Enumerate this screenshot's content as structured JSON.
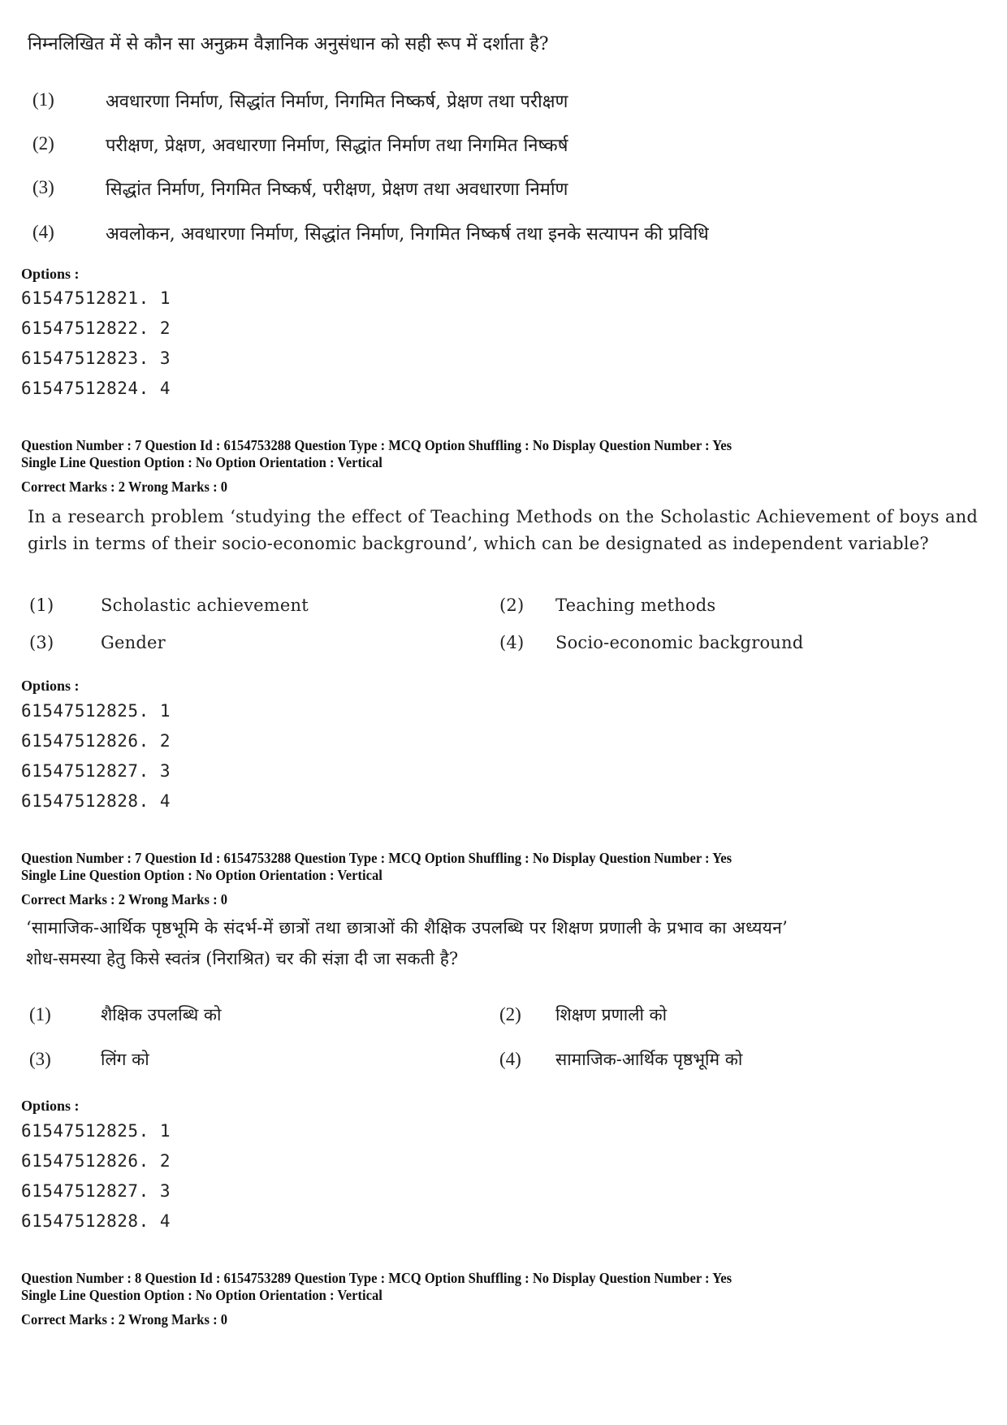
{
  "block1": {
    "question_text": "निम्नलिखित में से कौन सा अनुक्रम वैज्ञानिक अनुसंधान को सही रूप में दर्शाता है?",
    "choices": [
      {
        "num": "(1)",
        "text": "अवधारणा निर्माण, सिद्धांत निर्माण, निगमित निष्कर्ष, प्रेक्षण तथा परीक्षण"
      },
      {
        "num": "(2)",
        "text": "परीक्षण, प्रेक्षण, अवधारणा निर्माण, सिद्धांत निर्माण तथा निगमित निष्कर्ष"
      },
      {
        "num": "(3)",
        "text": "सिद्धांत निर्माण, निगमित निष्कर्ष, परीक्षण, प्रेक्षण तथा अवधारणा निर्माण"
      },
      {
        "num": "(4)",
        "text": "अवलोकन, अवधारणा निर्माण, सिद्धांत निर्माण, निगमित निष्कर्ष तथा इनके सत्यापन की प्रविधि"
      }
    ],
    "options_label": "Options :",
    "option_ids": [
      "61547512821. 1",
      "61547512822. 2",
      "61547512823. 3",
      "61547512824. 4"
    ]
  },
  "block2": {
    "meta_line1": "Question Number : 7  Question Id : 6154753288  Question Type : MCQ  Option Shuffling : No  Display Question Number : Yes",
    "meta_line2": "Single Line Question Option : No  Option Orientation : Vertical",
    "marks": "Correct Marks : 2  Wrong Marks : 0",
    "question_text": "In a research problem ‘studying the effect of Teaching Methods on the Scholastic Achievement of boys and girls in terms of their socio-economic background’, which can be designated as independent variable?",
    "choices": [
      {
        "num": "(1)",
        "text": "Scholastic achievement"
      },
      {
        "num": "(2)",
        "text": "Teaching methods"
      },
      {
        "num": "(3)",
        "text": "Gender"
      },
      {
        "num": "(4)",
        "text": "Socio-economic background"
      }
    ],
    "options_label": "Options :",
    "option_ids": [
      "61547512825. 1",
      "61547512826. 2",
      "61547512827. 3",
      "61547512828. 4"
    ]
  },
  "block3": {
    "meta_line1": "Question Number : 7  Question Id : 6154753288  Question Type : MCQ  Option Shuffling : No  Display Question Number : Yes",
    "meta_line2": "Single Line Question Option : No  Option Orientation : Vertical",
    "marks": "Correct Marks : 2  Wrong Marks : 0",
    "question_line1": "‘सामाजिक-आर्थिक पृष्ठभूमि के संदर्भ-में छात्रों तथा छात्राओं की शैक्षिक उपलब्धि पर शिक्षण प्रणाली के प्रभाव का अध्ययन’",
    "question_line2": "शोध-समस्या हेतु किसे स्वतंत्र (निराश्रित) चर की संज्ञा दी जा सकती है?",
    "choices": [
      {
        "num": "(1)",
        "text": "शैक्षिक उपलब्धि को"
      },
      {
        "num": "(2)",
        "text": "शिक्षण प्रणाली को"
      },
      {
        "num": "(3)",
        "text": "लिंग को"
      },
      {
        "num": "(4)",
        "text": "सामाजिक-आर्थिक पृष्ठभूमि को"
      }
    ],
    "options_label": "Options :",
    "option_ids": [
      "61547512825. 1",
      "61547512826. 2",
      "61547512827. 3",
      "61547512828. 4"
    ]
  },
  "block4": {
    "meta_line1": "Question Number : 8  Question Id : 6154753289  Question Type : MCQ  Option Shuffling : No  Display Question Number : Yes",
    "meta_line2": "Single Line Question Option : No  Option Orientation : Vertical",
    "marks": "Correct Marks : 2  Wrong Marks : 0"
  }
}
